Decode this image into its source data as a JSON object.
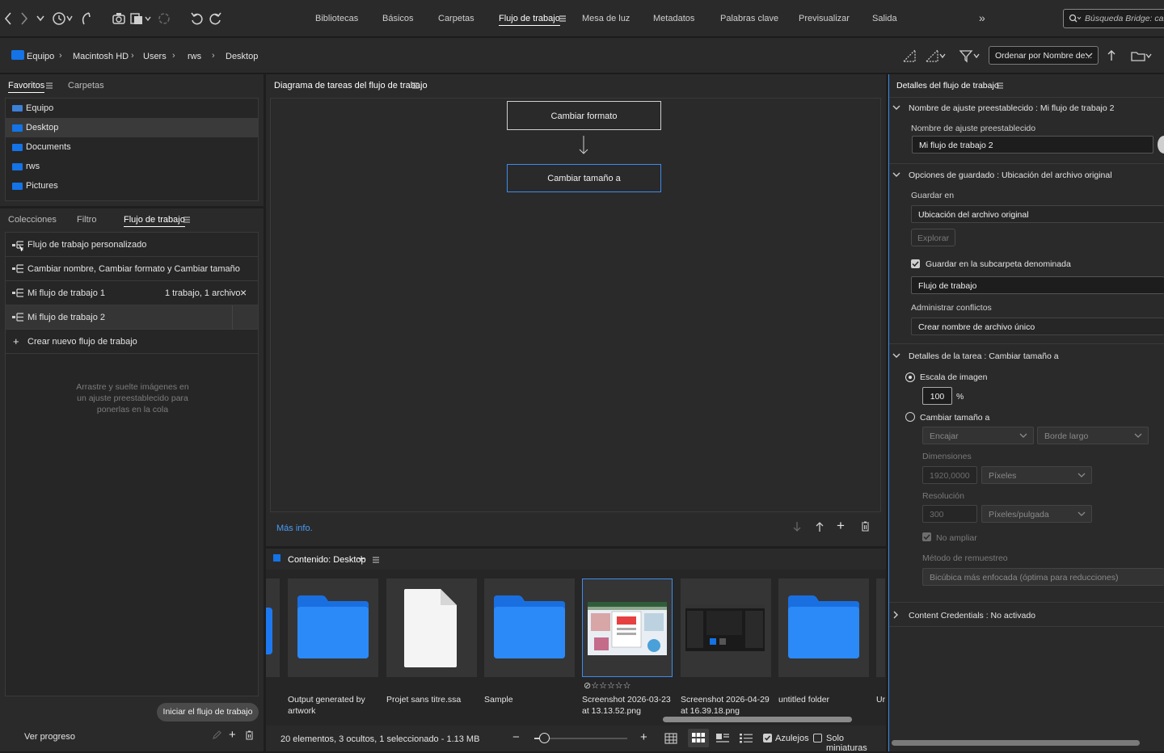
{
  "window": {
    "accent_color": "#1473e6",
    "panel_color": "#2a2a2a"
  },
  "toolbar": {
    "icons": [
      "back-icon",
      "forward-icon",
      "chevron-down-icon",
      "recent-icon",
      "boomerang-icon",
      "camera-icon",
      "stack-icon",
      "refine-icon",
      "rotate-left-icon",
      "rotate-right-icon"
    ]
  },
  "workspaces": {
    "items": [
      "Bibliotecas",
      "Básicos",
      "Carpetas",
      "Flujo de trabajo",
      "Mesa de luz",
      "Metadatos",
      "Palabras clave",
      "Previsualizar",
      "Salida"
    ],
    "active": "Flujo de trabajo"
  },
  "search": {
    "placeholder": "Búsqueda Bridge: carpe"
  },
  "breadcrumb": {
    "items": [
      "Equipo",
      "Macintosh HD",
      "Users",
      "rws",
      "Desktop"
    ]
  },
  "sort": {
    "label": "Ordenar por Nombre de..."
  },
  "favorites_panel": {
    "tabs": [
      "Favoritos",
      "Carpetas"
    ],
    "items": [
      "Equipo",
      "Desktop",
      "Documents",
      "rws",
      "Pictures"
    ],
    "selected": "Desktop"
  },
  "workflow_panel": {
    "tabs": [
      "Colecciones",
      "Filtro",
      "Flujo de trabajo"
    ],
    "items": [
      {
        "name": "Flujo de trabajo personalizado",
        "info": ""
      },
      {
        "name": "Cambiar nombre, Cambiar formato y Cambiar tamaño",
        "info": ""
      },
      {
        "name": "Mi flujo de trabajo 1",
        "info": "1 trabajo, 1 archivo"
      },
      {
        "name": "Mi flujo de trabajo 2",
        "info": ""
      }
    ],
    "create_label": "Crear nuevo flujo de trabajo",
    "drop_hint": "Arrastre y suelte imágenes en un ajuste preestablecido para ponerlas en la cola",
    "start_button": "Iniciar el flujo de trabajo",
    "progress_label": "Ver progreso"
  },
  "diagram": {
    "title": "Diagrama de tareas del flujo de trabajo",
    "tasks": [
      "Cambiar formato",
      "Cambiar tamaño a"
    ],
    "more_info": "Más info."
  },
  "content": {
    "title": "Contenido: Desktop",
    "items": [
      {
        "name": "Output generated by artwork",
        "type": "folder"
      },
      {
        "name": "Projet sans titre.ssa",
        "type": "file"
      },
      {
        "name": "Sample",
        "type": "folder"
      },
      {
        "name": "Screenshot 2026-03-23 at 13.13.52.png",
        "type": "image",
        "selected": true
      },
      {
        "name": "Screenshot 2026-04-29 at 16.39.18.png",
        "type": "image-dark"
      },
      {
        "name": "untitled folder",
        "type": "folder"
      },
      {
        "name": "Ur",
        "type": "partial"
      }
    ],
    "rating": "☆☆☆☆☆",
    "status": "20 elementos, 3 ocultos, 1 seleccionado - 1.13 MB",
    "thumbs_only_label": "Solo miniaturas",
    "tiles_label": "Azulejos",
    "tiles_checked": true,
    "thumbs_only_checked": false,
    "zoom_level": 0.1
  },
  "details": {
    "title": "Detalles del flujo de trabajo",
    "preset_section": "Nombre de ajuste preestablecido : Mi flujo de trabajo 2",
    "preset_label": "Nombre de ajuste preestablecido",
    "preset_value": "Mi flujo de trabajo 2",
    "save_section": "Opciones de guardado : Ubicación del archivo original",
    "save_in_label": "Guardar en",
    "save_in_value": "Ubicación del archivo original",
    "browse_button": "Explorar",
    "subfolder_label": "Guardar en la subcarpeta denominada",
    "subfolder_value": "Flujo de trabajo",
    "conflicts_label": "Administrar conflictos",
    "conflicts_value": "Crear nombre de archivo único",
    "task_section": "Detalles de la tarea : Cambiar tamaño a",
    "scale_label": "Escala de imagen",
    "scale_value": "100",
    "scale_unit": "%",
    "resize_label": "Cambiar tamaño a",
    "fit_value": "Encajar",
    "edge_value": "Borde largo",
    "dimensions_label": "Dimensiones",
    "dimensions_value": "1920,0000",
    "dimensions_unit": "Píxeles",
    "resolution_label": "Resolución",
    "resolution_value": "300",
    "resolution_unit": "Píxeles/pulgada",
    "no_enlarge_label": "No ampliar",
    "resample_label": "Método de remuestreo",
    "resample_value": "Bicúbica más enfocada (óptima para reducciones)",
    "credentials_section": "Content Credentials : No activado"
  }
}
